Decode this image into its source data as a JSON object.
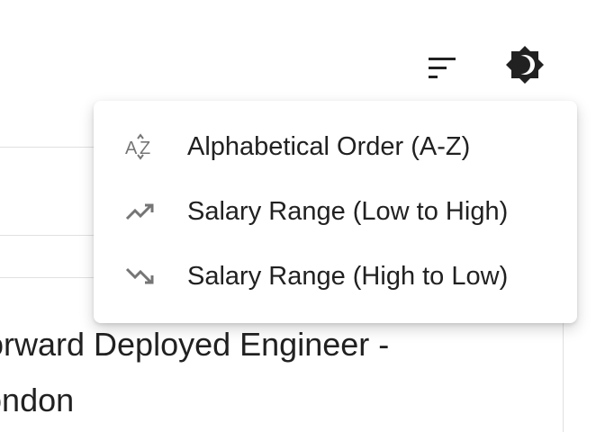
{
  "toolbar": {
    "sort_icon": "sort-icon",
    "theme_icon": "brightness-icon"
  },
  "sort_menu": {
    "items": [
      {
        "label": "Alphabetical Order (A-Z)",
        "icon": "sort-by-alpha-icon"
      },
      {
        "label": "Salary Range (Low to High)",
        "icon": "trending-up-icon"
      },
      {
        "label": "Salary Range (High to Low)",
        "icon": "trending-down-icon"
      }
    ]
  },
  "job_card": {
    "title": "Forward Deployed Engineer - London"
  },
  "colors": {
    "icon": "#212121",
    "menu_icon": "#757575",
    "divider": "#e0e0e0"
  }
}
